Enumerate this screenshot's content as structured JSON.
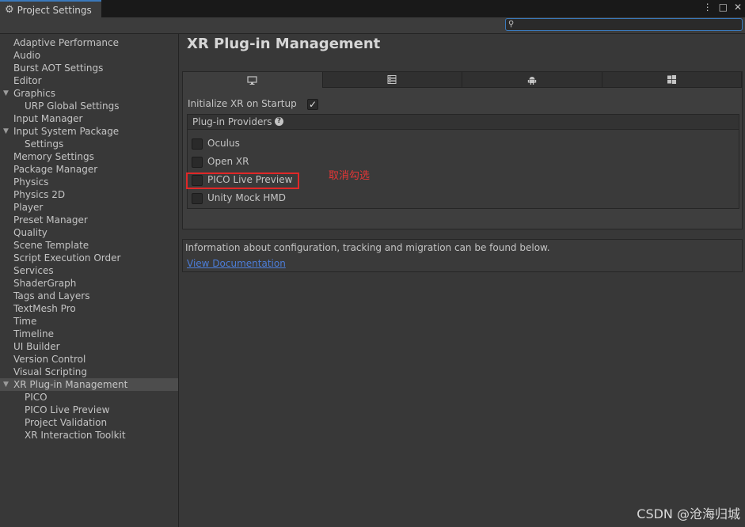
{
  "window": {
    "tab_title": "Project Settings",
    "controls": [
      "⋮",
      "□",
      "✕"
    ]
  },
  "search": {
    "placeholder": "",
    "icon": "search-icon"
  },
  "sidebar": {
    "items": [
      {
        "label": "Adaptive Performance",
        "indent": 0,
        "expandable": false,
        "selected": false
      },
      {
        "label": "Audio",
        "indent": 0,
        "expandable": false,
        "selected": false
      },
      {
        "label": "Burst AOT Settings",
        "indent": 0,
        "expandable": false,
        "selected": false
      },
      {
        "label": "Editor",
        "indent": 0,
        "expandable": false,
        "selected": false
      },
      {
        "label": "Graphics",
        "indent": 0,
        "expandable": true,
        "selected": false
      },
      {
        "label": "URP Global Settings",
        "indent": 1,
        "expandable": false,
        "selected": false
      },
      {
        "label": "Input Manager",
        "indent": 0,
        "expandable": false,
        "selected": false
      },
      {
        "label": "Input System Package",
        "indent": 0,
        "expandable": true,
        "selected": false
      },
      {
        "label": "Settings",
        "indent": 1,
        "expandable": false,
        "selected": false
      },
      {
        "label": "Memory Settings",
        "indent": 0,
        "expandable": false,
        "selected": false
      },
      {
        "label": "Package Manager",
        "indent": 0,
        "expandable": false,
        "selected": false
      },
      {
        "label": "Physics",
        "indent": 0,
        "expandable": false,
        "selected": false
      },
      {
        "label": "Physics 2D",
        "indent": 0,
        "expandable": false,
        "selected": false
      },
      {
        "label": "Player",
        "indent": 0,
        "expandable": false,
        "selected": false
      },
      {
        "label": "Preset Manager",
        "indent": 0,
        "expandable": false,
        "selected": false
      },
      {
        "label": "Quality",
        "indent": 0,
        "expandable": false,
        "selected": false
      },
      {
        "label": "Scene Template",
        "indent": 0,
        "expandable": false,
        "selected": false
      },
      {
        "label": "Script Execution Order",
        "indent": 0,
        "expandable": false,
        "selected": false
      },
      {
        "label": "Services",
        "indent": 0,
        "expandable": false,
        "selected": false
      },
      {
        "label": "ShaderGraph",
        "indent": 0,
        "expandable": false,
        "selected": false
      },
      {
        "label": "Tags and Layers",
        "indent": 0,
        "expandable": false,
        "selected": false
      },
      {
        "label": "TextMesh Pro",
        "indent": 0,
        "expandable": false,
        "selected": false
      },
      {
        "label": "Time",
        "indent": 0,
        "expandable": false,
        "selected": false
      },
      {
        "label": "Timeline",
        "indent": 0,
        "expandable": false,
        "selected": false
      },
      {
        "label": "UI Builder",
        "indent": 0,
        "expandable": false,
        "selected": false
      },
      {
        "label": "Version Control",
        "indent": 0,
        "expandable": false,
        "selected": false
      },
      {
        "label": "Visual Scripting",
        "indent": 0,
        "expandable": false,
        "selected": false
      },
      {
        "label": "XR Plug-in Management",
        "indent": 0,
        "expandable": true,
        "selected": true
      },
      {
        "label": "PICO",
        "indent": 1,
        "expandable": false,
        "selected": false
      },
      {
        "label": "PICO Live Preview",
        "indent": 1,
        "expandable": false,
        "selected": false
      },
      {
        "label": "Project Validation",
        "indent": 1,
        "expandable": false,
        "selected": false
      },
      {
        "label": "XR Interaction Toolkit",
        "indent": 1,
        "expandable": false,
        "selected": false
      }
    ]
  },
  "main": {
    "title": "XR Plug-in Management",
    "platform_tabs": [
      {
        "icon": "desktop-icon",
        "active": true
      },
      {
        "icon": "server-icon",
        "active": false
      },
      {
        "icon": "android-icon",
        "active": false
      },
      {
        "icon": "windows-icon",
        "active": false
      }
    ],
    "init_label": "Initialize XR on Startup",
    "init_checked": true,
    "providers_title": "Plug-in Providers",
    "providers": [
      {
        "label": "Oculus",
        "checked": false
      },
      {
        "label": "Open XR",
        "checked": false
      },
      {
        "label": "PICO Live Preview",
        "checked": false
      },
      {
        "label": "Unity Mock HMD",
        "checked": false
      }
    ],
    "annotation": "取消勾选",
    "info_text": "Information about configuration, tracking and migration can be found below.",
    "info_link": "View Documentation"
  },
  "watermark": "CSDN @沧海归城",
  "colors": {
    "accent": "#3a79bb",
    "highlight": "#e02828",
    "link": "#4c7dd8"
  }
}
